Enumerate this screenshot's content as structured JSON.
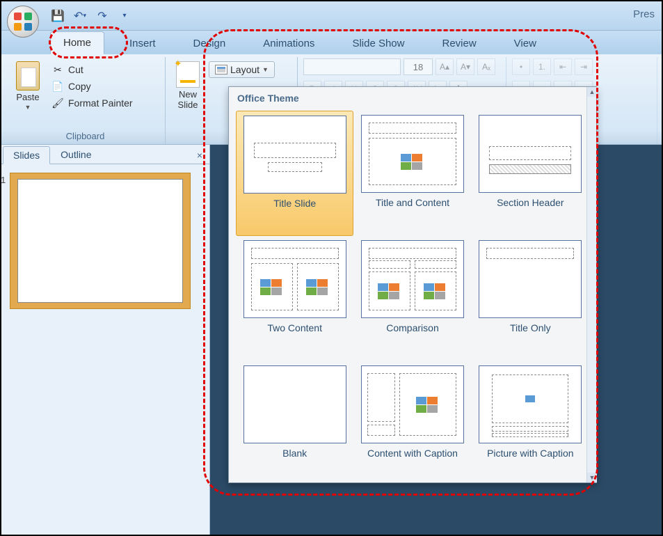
{
  "titlebar": {
    "doc_title": "Pres"
  },
  "qat": {
    "save": "💾",
    "undo": "↶",
    "redo": "↷"
  },
  "tabs": {
    "home": "Home",
    "insert": "Insert",
    "design": "Design",
    "animations": "Animations",
    "slideshow": "Slide Show",
    "review": "Review",
    "view": "View"
  },
  "clipboard": {
    "paste": "Paste",
    "cut": "Cut",
    "copy": "Copy",
    "format_painter": "Format Painter",
    "group_label": "Clipboard"
  },
  "slides_group": {
    "new_slide": "New\nSlide",
    "layout": "Layout"
  },
  "font": {
    "size": "18"
  },
  "panel": {
    "slides_tab": "Slides",
    "outline_tab": "Outline",
    "slide_num": "1"
  },
  "layout_popup": {
    "header": "Office Theme",
    "items": [
      {
        "label": "Title Slide",
        "kind": "title",
        "selected": true
      },
      {
        "label": "Title and Content",
        "kind": "title_content",
        "selected": false
      },
      {
        "label": "Section Header",
        "kind": "section",
        "selected": false
      },
      {
        "label": "Two Content",
        "kind": "two_content",
        "selected": false
      },
      {
        "label": "Comparison",
        "kind": "comparison",
        "selected": false
      },
      {
        "label": "Title Only",
        "kind": "title_only",
        "selected": false
      },
      {
        "label": "Blank",
        "kind": "blank",
        "selected": false
      },
      {
        "label": "Content with Caption",
        "kind": "content_caption",
        "selected": false
      },
      {
        "label": "Picture with Caption",
        "kind": "picture_caption",
        "selected": false
      }
    ]
  }
}
